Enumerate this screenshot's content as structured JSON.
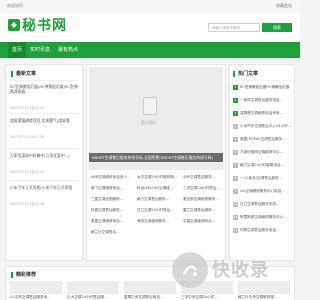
{
  "topbar": {
    "left": "欢迎访问",
    "right": "收藏此站"
  },
  "header": {
    "logo_text": "秘书网",
    "search_placeholder": "请输入搜索关键词",
    "search_button": "搜索"
  },
  "nav": {
    "items": [
      "首页",
      "实时讯息",
      "最有热点"
    ]
  },
  "latest": {
    "title": "最新文章",
    "items": [
      {
        "text": "RC型弹簧阻尼器(RC弹簧阻尼器)RC型弹簧减振器",
        "date": "2023-07-21 06:11:39"
      },
      {
        "text": "滦屏蓬镇建楼项目,实现暖气(滦屏蓬",
        "date": "2023-07-21 06:11:39"
      },
      {
        "text": "万家优惠网中秋聚中(万家优惠中...)",
        "date": "2023-07-21 06:11:39"
      },
      {
        "text": "小米汽车正式亮相(小米汽车正式亮相",
        "date": "2023-07-21 06:11:38"
      }
    ]
  },
  "main": {
    "placeholder_text": "暂无图片",
    "caption": "KBORT空调售后服务热线号码-全国免费(KBORT空调售后服务热线号码)",
    "grid": [
      "AKB空调维修电话多少...",
      "太平空调24小时维修服...",
      "长岭空调售后服务...",
      "新飞空调维修电话...",
      "科龙(KELON)空调维...",
      "三洋空调24小时售后...",
      "三菱空调全国维修...",
      "格力空调售后服务...",
      "奥克斯空调维修服务...",
      "科夏空调售后服务...",
      "日立空调24小时售后...",
      "春兰空调售后维修...",
      "美菱空调维修电话...",
      "海信空调维修服务...",
      "志高空调维修网点...",
      "格兰仕空调售后..."
    ]
  },
  "hot": {
    "title": "热门文章",
    "items": [
      {
        "num": "1",
        "text": "RC型弹簧阻尼器RC弹簧阻尼器..."
      },
      {
        "num": "2",
        "text": "一新风空调售后服务电话..."
      },
      {
        "num": "3",
        "text": "滦屏蓬空调维修电话号码..."
      },
      {
        "num": "4",
        "text": "小米汽车空调售后中心24小时..."
      },
      {
        "num": "5",
        "text": "美菱(KOMA)空调售后服务..."
      },
      {
        "num": "6",
        "text": "万家优惠网空调维修中心..."
      },
      {
        "num": "7",
        "text": "格力空调24小时客服电话..."
      },
      {
        "num": "8",
        "text": "一(人新品)空调售后服务..."
      },
      {
        "num": "9",
        "text": "vip空调维修服务中心电话..."
      },
      {
        "num": "10",
        "text": "日立空调售后服务热线..."
      },
      {
        "num": "11",
        "text": "阿里斯顿空调维修服务中心..."
      },
      {
        "num": "12",
        "text": "利群空调售后服务电话..."
      }
    ]
  },
  "reco": {
    "title": "精彩推荐",
    "items": [
      "LG中央空调售后服务电...",
      "丘大空调24小时售后服...",
      "盈翠中央空调售后电话...",
      "三洋中央空调24小时...",
      "格兰仕中央空调维修服..."
    ]
  },
  "watermark": {
    "text": "快收录"
  }
}
